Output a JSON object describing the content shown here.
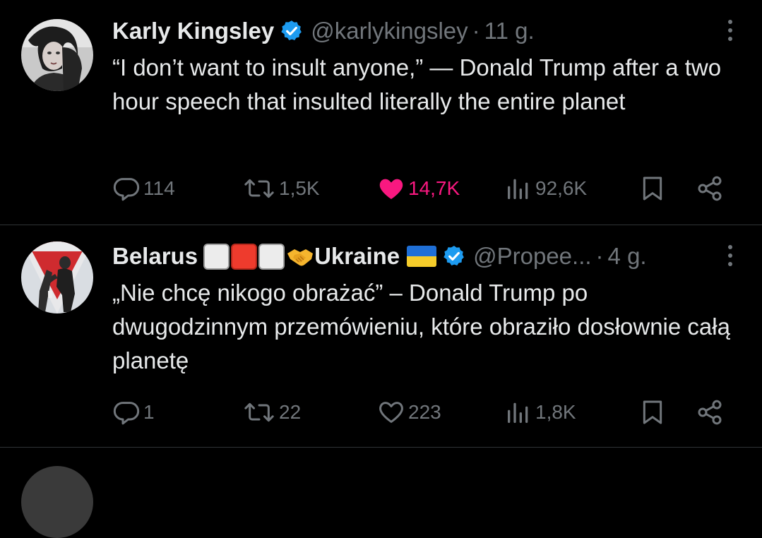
{
  "colors": {
    "background": "#000000",
    "text": "#e7e9ea",
    "muted": "#71767b",
    "divider": "#2f3336",
    "like_active": "#f91880",
    "verified": "#1d9bf0"
  },
  "tweets": [
    {
      "name": "Karly Kingsley",
      "verified": true,
      "handle": "@karlykingsley",
      "separator": "·",
      "time": "11 g.",
      "text": "“I don’t want to insult anyone,” — Donald  Trump after a two hour speech that insulted literally the entire planet",
      "actions": {
        "replies": "114",
        "reposts": "1,5K",
        "likes": "14,7K",
        "liked": true,
        "views": "92,6K"
      },
      "icons": [
        "reply-icon",
        "repost-icon",
        "heart-filled-icon",
        "views-icon",
        "bookmark-icon",
        "share-icon",
        "more-icon"
      ]
    },
    {
      "name": "Belarus",
      "name_emoji": [
        "white-square",
        "red-square",
        "white-square",
        "handshake"
      ],
      "name_tail": "Ukraine",
      "name_flag": "ukraine-flag",
      "verified": true,
      "handle": "@Propee...",
      "separator": "·",
      "time": "4 g.",
      "text": "„Nie chcę nikogo obrażać” – Donald Trump po dwugodzinnym przemówieniu, które obraziło dosłownie całą planetę",
      "actions": {
        "replies": "1",
        "reposts": "22",
        "likes": "223",
        "liked": false,
        "views": "1,8K"
      },
      "icons": [
        "reply-icon",
        "repost-icon",
        "heart-icon",
        "views-icon",
        "bookmark-icon",
        "share-icon",
        "more-icon"
      ]
    }
  ]
}
